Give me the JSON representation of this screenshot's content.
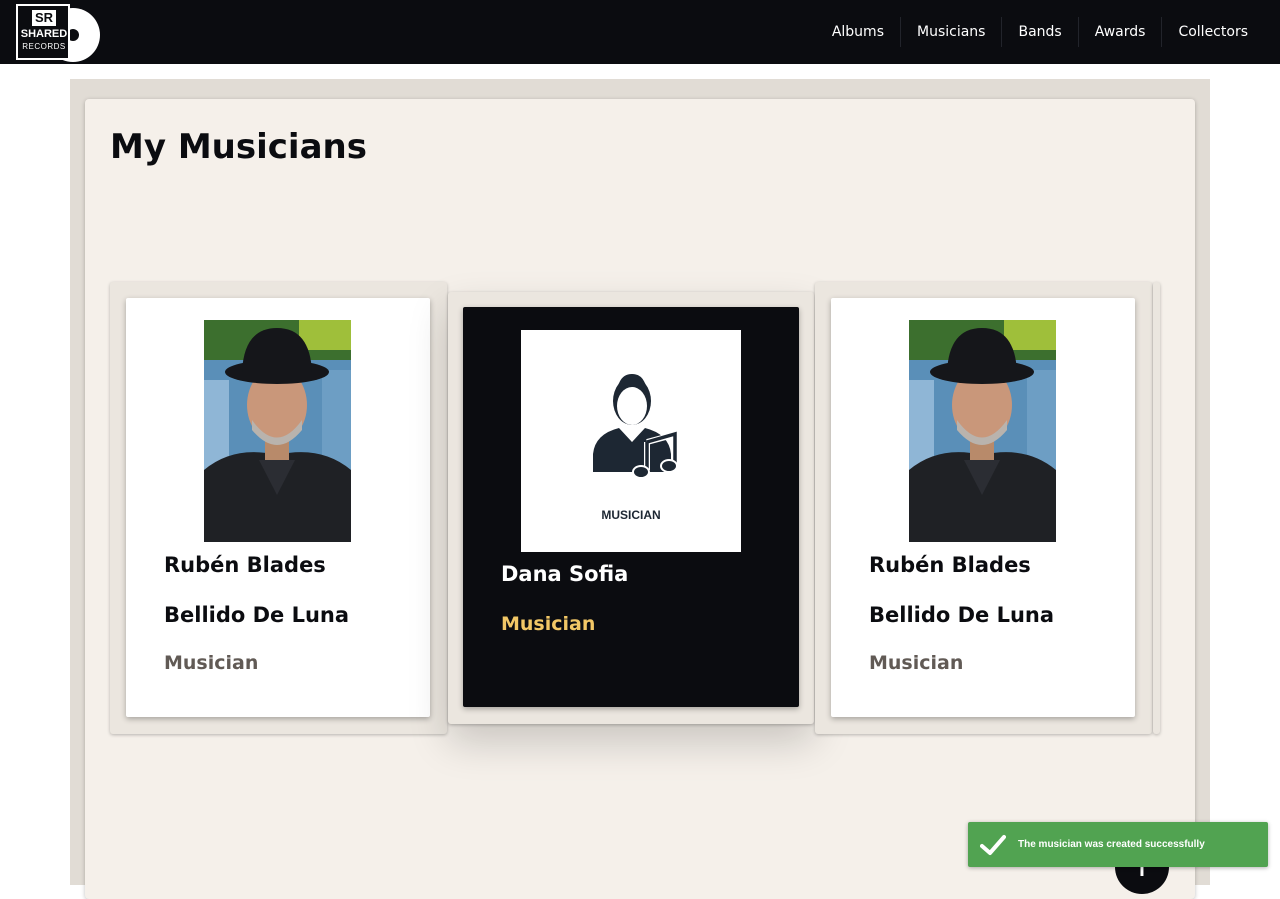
{
  "brand": {
    "logo_sr": "SR",
    "logo_shared": "SHARED",
    "logo_records": "RECORDS"
  },
  "nav": {
    "links": [
      "Albums",
      "Musicians",
      "Bands",
      "Awards",
      "Collectors"
    ]
  },
  "page": {
    "title": "My Musicians"
  },
  "musicians": [
    {
      "name": "Rubén Blades Bellido De Luna",
      "role": "Musician",
      "image": "photo"
    },
    {
      "name": "Dana Sofia",
      "role": "Musician",
      "image": "placeholder",
      "placeholder_label": "MUSICIAN"
    },
    {
      "name": "Rubén Blades Bellido De Luna",
      "role": "Musician",
      "image": "photo"
    }
  ],
  "fab": {
    "icon": "plus-icon"
  },
  "toast": {
    "message": "The musician was created successfully",
    "icon": "check-icon"
  },
  "colors": {
    "navbar": "#0b0c10",
    "outer_background": "#e1dcd5",
    "panel_background": "#f5f0ea",
    "active_card": "#0b0c10",
    "active_role": "#f2c766",
    "role_text": "#615a55",
    "toast": "#51a351"
  }
}
